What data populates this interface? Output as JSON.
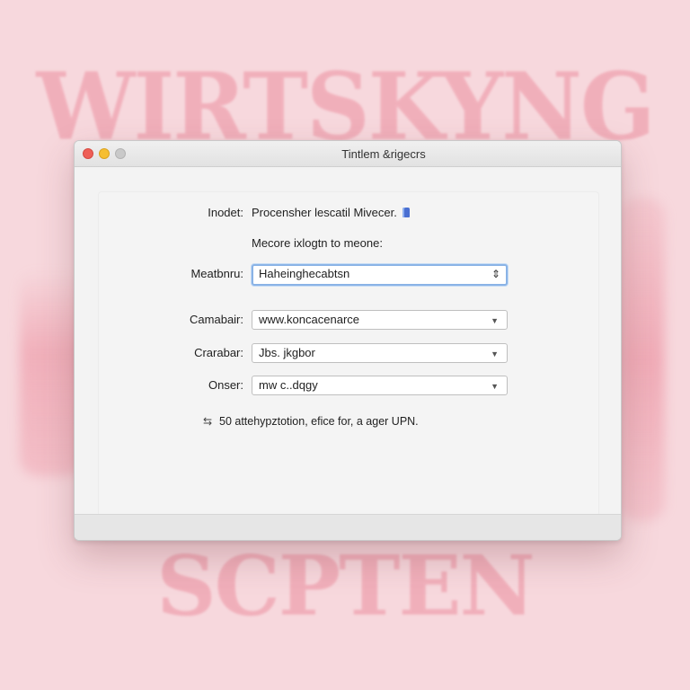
{
  "background": {
    "top_lettering": "WIRTSKYNG",
    "bottom_lettering": "SCPTEN"
  },
  "window": {
    "title": "Tintlem &rigecrs",
    "controls": {
      "close": "#ee5f57",
      "minimize": "#f6be30",
      "zoom": "#c9c9c9"
    }
  },
  "form": {
    "header_label": "Inodet:",
    "header_value": "Procensher lescatil Mivecer.",
    "header_icon": "info-icon",
    "subtitle": "Mecore ixlogtn to meone:",
    "method": {
      "label": "Meatbnru:",
      "value": "Haheinghecabtsn",
      "icon": "stepper-icon",
      "symbol": "⇕"
    },
    "camabair": {
      "label": "Camabair:",
      "value": "www.koncacenarce",
      "icon": "chevron-down-icon",
      "symbol": "▼"
    },
    "crarabar": {
      "label": "Crarabar:",
      "value": "Jbs. jkgbor",
      "icon": "chevron-down-icon",
      "symbol": "▼"
    },
    "onser": {
      "label": "Onser:",
      "value": "mw c..dqgy",
      "icon": "chevron-down-icon",
      "symbol": "▼"
    },
    "footnote": {
      "icon": "note-icon",
      "symbol": "⇆",
      "text": "50 attehypztotion, efice for, a ager UPN."
    }
  },
  "colors": {
    "accent_focus": "#8ab3e6",
    "page_background": "#f7d8dd",
    "lettering": "#ec8f9f"
  }
}
